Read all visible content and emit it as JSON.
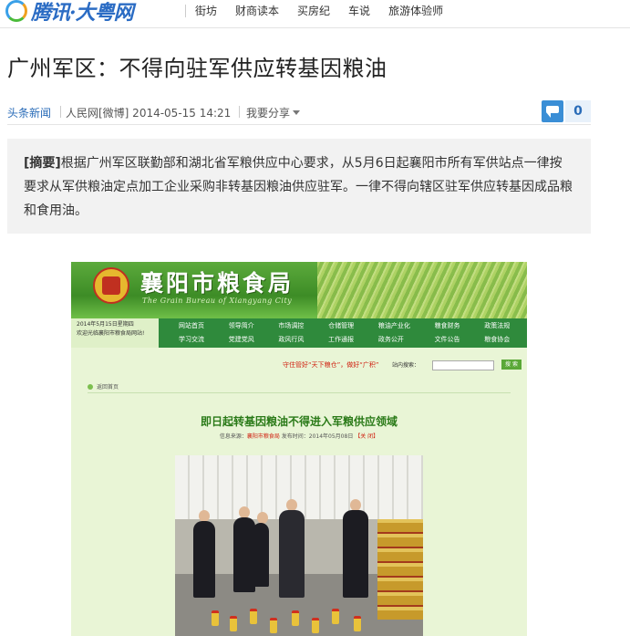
{
  "header": {
    "logo_text": "腾讯·大粤网",
    "nav": [
      "街坊",
      "财商读本",
      "买房纪",
      "车说",
      "旅游体验师"
    ]
  },
  "article": {
    "title": "广州军区：不得向驻军供应转基因粮油",
    "channel": "头条新闻",
    "source": "人民网[微博] 2014-05-15 14:21",
    "share_label": "我要分享",
    "comment_count": "0",
    "summary_label": "[摘要]",
    "summary_text": "根据广州军区联勤部和湖北省军粮供应中心要求，从5月6日起襄阳市所有军供站点一律按要求从军供粮油定点加工企业采购非转基因粮油供应驻军。一律不得向辖区驻军供应转基因成品粮和食用油。"
  },
  "photo": {
    "site_name": "襄阳市粮食局",
    "site_subtitle": "The Grain Bureau of Xiangyang City",
    "date_line1": "2014年5月15日星期四",
    "date_line2": "欢迎光临襄阳市粮食局网站!",
    "nav_items": [
      "网站首页",
      "领导简介",
      "市场调控",
      "仓储管理",
      "粮油产业化",
      "粮食财务",
      "政策法规",
      "行政权力 / 服务事项",
      "学习交流",
      "党建党风",
      "政风行风",
      "工作通报",
      "政务公开",
      "文件公告",
      "粮食协会",
      "粮食与健康"
    ],
    "slogan": "守住管好“天下粮仓”，做好“广积”",
    "search_label": "站内搜索：",
    "search_button": "搜 索",
    "breadcrumb": "返回首页",
    "article_title": "即日起转基因粮油不得进入军粮供应领域",
    "article_meta_prefix": "信息来源：",
    "article_meta_source": "襄阳市粮食局",
    "article_meta_time": "发布时间：2014年05月08日",
    "article_meta_close": "【关 闭】"
  }
}
